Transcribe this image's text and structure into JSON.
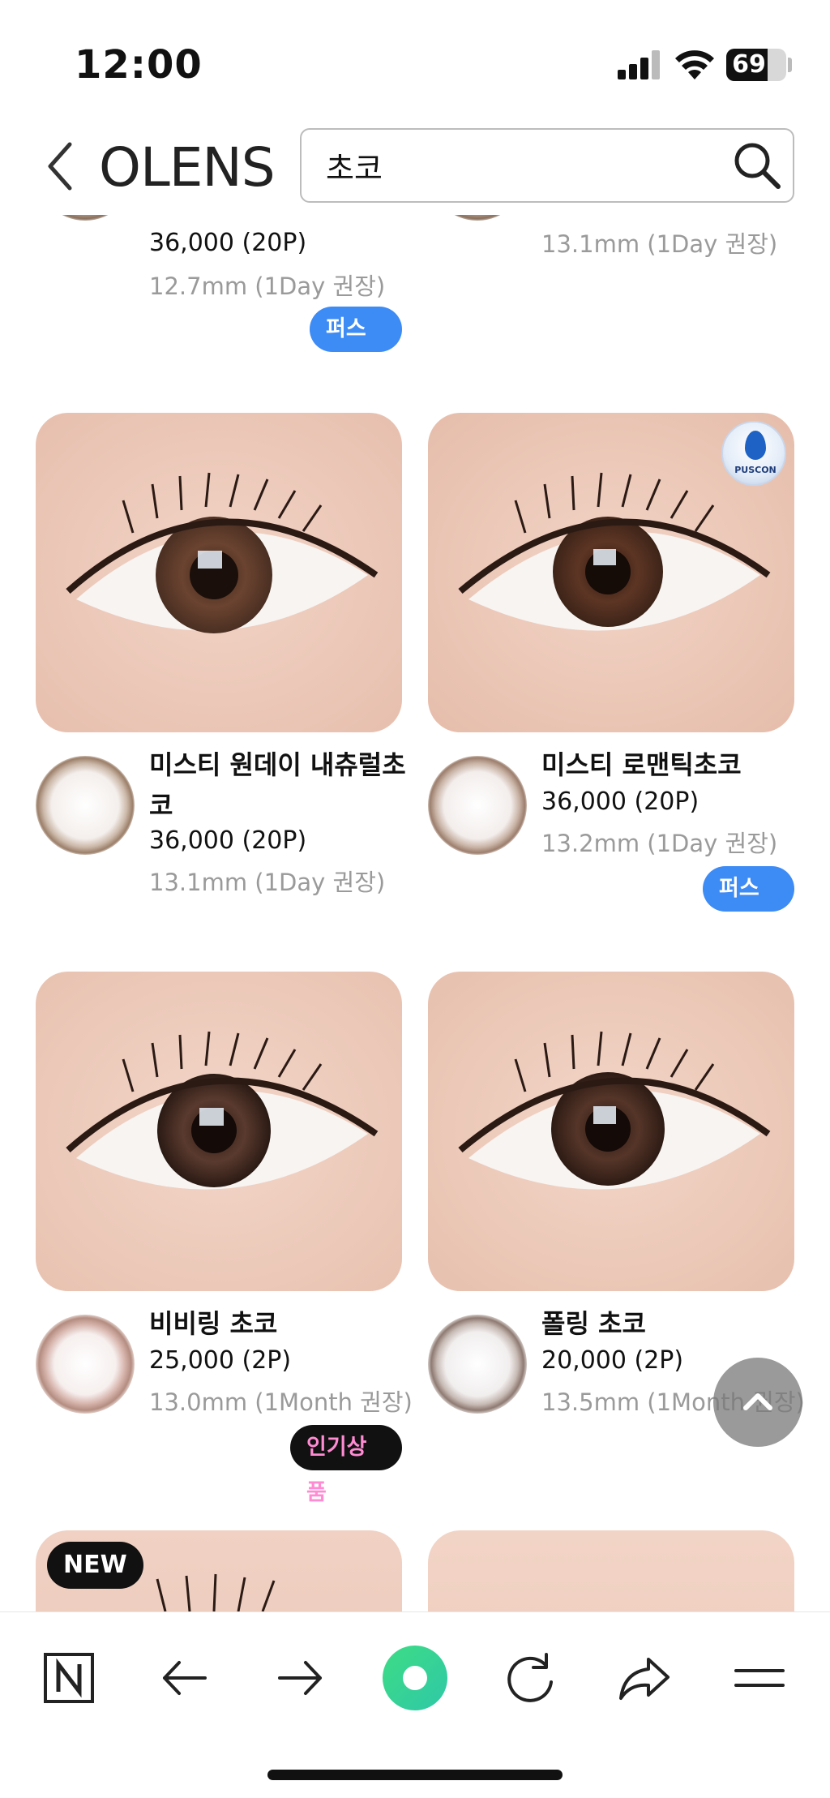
{
  "status_bar": {
    "time": "12:00",
    "battery_percent": 69,
    "battery_label": "69"
  },
  "header": {
    "logo": "OLENS",
    "search": {
      "value": "초코",
      "placeholder": ""
    }
  },
  "products": [
    {
      "name": "",
      "price": "36,000 (20P)",
      "spec": "12.7mm (1Day 권장)",
      "badge": "퍼스콘"
    },
    {
      "name": "",
      "price": "",
      "spec": "13.1mm (1Day 권장)",
      "badge": ""
    },
    {
      "name": "미스티 원데이 내츄럴초코",
      "price": "36,000 (20P)",
      "spec": "13.1mm (1Day 권장)",
      "badge": ""
    },
    {
      "name": "미스티 로맨틱초코",
      "price": "36,000 (20P)",
      "spec": "13.2mm (1Day 권장)",
      "badge": "퍼스콘",
      "image_badge": "PUSCON"
    },
    {
      "name": "비비링 초코",
      "price": "25,000 (2P)",
      "spec": "13.0mm (1Month 권장)",
      "badge": "인기상품"
    },
    {
      "name": "폴링 초코",
      "price": "20,000 (2P)",
      "spec": "13.5mm (1Month 권장)",
      "badge": ""
    },
    {
      "name": "",
      "price": "",
      "spec": "",
      "badge": "",
      "image_badge": "NEW"
    },
    {
      "name": "",
      "price": "",
      "spec": "",
      "badge": ""
    }
  ],
  "bottom_nav": {
    "items": [
      "naver-n-icon",
      "back-arrow-icon",
      "forward-arrow-icon",
      "green-dot-icon",
      "reload-icon",
      "share-icon",
      "menu-icon"
    ]
  },
  "colors": {
    "badge_blue": "#3d8bf5",
    "badge_dark": "#111111",
    "badge_dark_text": "#ff8bd3",
    "green": "#3ddc84"
  }
}
